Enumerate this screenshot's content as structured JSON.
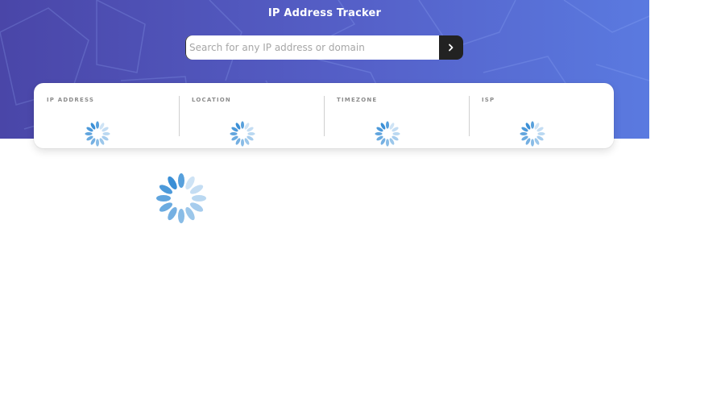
{
  "header": {
    "title": "IP Address Tracker"
  },
  "search": {
    "placeholder": "Search for any IP address or domain",
    "value": "",
    "submit_icon": "chevron-right-icon"
  },
  "stats": [
    {
      "label": "IP ADDRESS",
      "value": "",
      "state": "loading"
    },
    {
      "label": "LOCATION",
      "value": "",
      "state": "loading"
    },
    {
      "label": "TIMEZONE",
      "value": "",
      "state": "loading"
    },
    {
      "label": "ISP",
      "value": "",
      "state": "loading"
    }
  ],
  "map": {
    "state": "loading",
    "icon": "loading-spinner-icon"
  },
  "colors": {
    "hero_start": "#4a46a8",
    "hero_end": "#5a7ae0",
    "button": "#222222",
    "label": "#8c8c8c",
    "spinner": "#3a8fd6"
  }
}
